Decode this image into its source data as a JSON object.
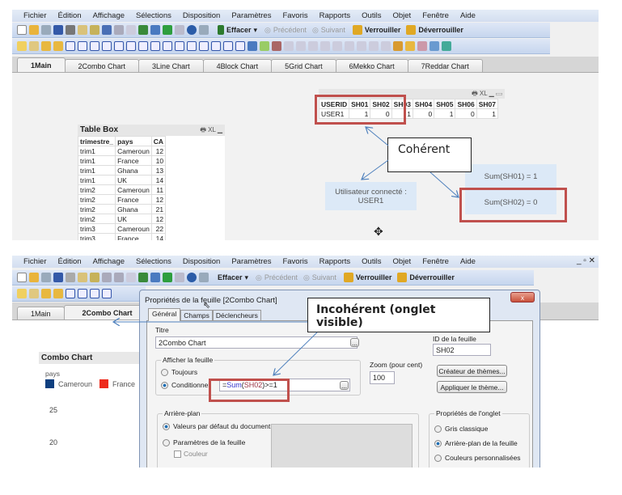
{
  "menu": [
    "Fichier",
    "Édition",
    "Affichage",
    "Sélections",
    "Disposition",
    "Paramètres",
    "Favoris",
    "Rapports",
    "Outils",
    "Objet",
    "Fenêtre",
    "Aide"
  ],
  "toolbar": {
    "clear": "Effacer",
    "back": "Précédent",
    "forward": "Suivant",
    "lock": "Verrouiller",
    "unlock": "Déverrouiller"
  },
  "tabs": [
    "1Main",
    "2Combo Chart",
    "3Line Chart",
    "4Block Chart",
    "5Grid Chart",
    "6Mekko Chart",
    "7Reddar Chart"
  ],
  "top": {
    "table_box": {
      "title": "Table Box",
      "columns": [
        "trimestre_",
        "pays",
        "CA"
      ],
      "rows": [
        [
          "trim1",
          "Cameroun",
          "12"
        ],
        [
          "trim1",
          "France",
          "10"
        ],
        [
          "trim1",
          "Ghana",
          "13"
        ],
        [
          "trim1",
          "UK",
          "14"
        ],
        [
          "trim2",
          "Cameroun",
          "11"
        ],
        [
          "trim2",
          "France",
          "12"
        ],
        [
          "trim2",
          "Ghana",
          "21"
        ],
        [
          "trim2",
          "UK",
          "12"
        ],
        [
          "trim3",
          "Cameroun",
          "22"
        ],
        [
          "trim3",
          "France",
          "14"
        ]
      ]
    },
    "access_table": {
      "columns": [
        "USERID",
        "SH01",
        "SH02",
        "SH03",
        "SH04",
        "SH05",
        "SH06",
        "SH07"
      ],
      "rows": [
        [
          "USER1",
          "1",
          "0",
          "1",
          "0",
          "1",
          "0",
          "1"
        ]
      ]
    },
    "user_label": "Utilisateur connecté : USER1",
    "sum_sh01": "Sum(SH01) = 1",
    "sum_sh02": "Sum(SH02) = 0",
    "callout": "Cohérent"
  },
  "bottom": {
    "callout": "Incohérent (onglet visible)",
    "chart": {
      "title": "Combo Chart",
      "legend_title": "pays",
      "legend": [
        {
          "name": "Cameroun",
          "color": "#0f3f7f"
        },
        {
          "name": "France",
          "color": "#ee2b1c"
        }
      ],
      "y_ticks": [
        "25",
        "20"
      ]
    },
    "dialog": {
      "title": "Propriétés de la feuille [2Combo Chart]",
      "tabs": [
        "Général",
        "Champs",
        "Déclencheurs"
      ],
      "titre_label": "Titre",
      "titre_value": "2Combo Chart",
      "id_label": "ID de la feuille",
      "id_value": "SH02",
      "show_group": "Afficher la feuille",
      "always": "Toujours",
      "conditional": "Conditionnel",
      "condition_eq": "=",
      "condition_fn": "Sum",
      "condition_paren_open": "(",
      "condition_field": "SH02",
      "condition_rest": ")>=1",
      "zoom_label": "Zoom (pour cent)",
      "zoom_value": "100",
      "theme_creator": "Créateur de thèmes...",
      "apply_theme": "Appliquer le thème...",
      "background_group": "Arrière-plan",
      "bg_default": "Valeurs par défaut du document",
      "bg_sheet": "Paramètres de la feuille",
      "bg_color": "Couleur",
      "tab_props_group": "Propriétés de l'onglet",
      "tab_classic": "Gris classique",
      "tab_sheet_bg": "Arrière-plan de la feuille",
      "tab_custom": "Couleurs personnalisées",
      "browse": "...",
      "close": "x"
    }
  }
}
